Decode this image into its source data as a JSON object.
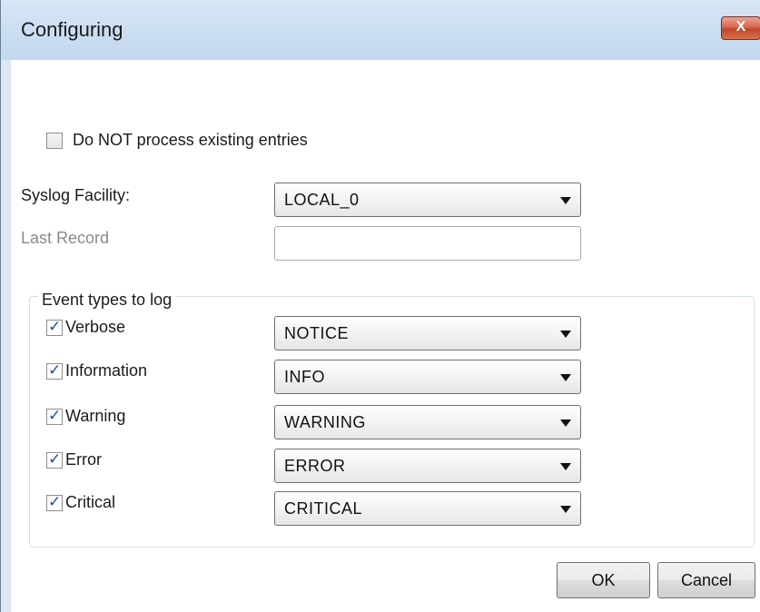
{
  "window": {
    "title": "Configuring",
    "close_label": "X"
  },
  "options": {
    "skip_existing": {
      "label": "Do NOT process existing entries",
      "checked": false
    }
  },
  "syslog_facility": {
    "label": "Syslog Facility:",
    "value": "LOCAL_0"
  },
  "last_record": {
    "label": "Last Record",
    "value": ""
  },
  "event_types": {
    "legend": "Event types to log",
    "rows": [
      {
        "label": "Verbose",
        "checked": true,
        "level": "NOTICE"
      },
      {
        "label": "Information",
        "checked": true,
        "level": "INFO"
      },
      {
        "label": "Warning",
        "checked": true,
        "level": "WARNING"
      },
      {
        "label": "Error",
        "checked": true,
        "level": "ERROR"
      },
      {
        "label": "Critical",
        "checked": true,
        "level": "CRITICAL"
      }
    ]
  },
  "buttons": {
    "ok": "OK",
    "cancel": "Cancel"
  },
  "colors": {
    "close_button": "#c2462d",
    "checkmark": "#1f4e9c",
    "disabled_text": "#8a8a8a"
  }
}
